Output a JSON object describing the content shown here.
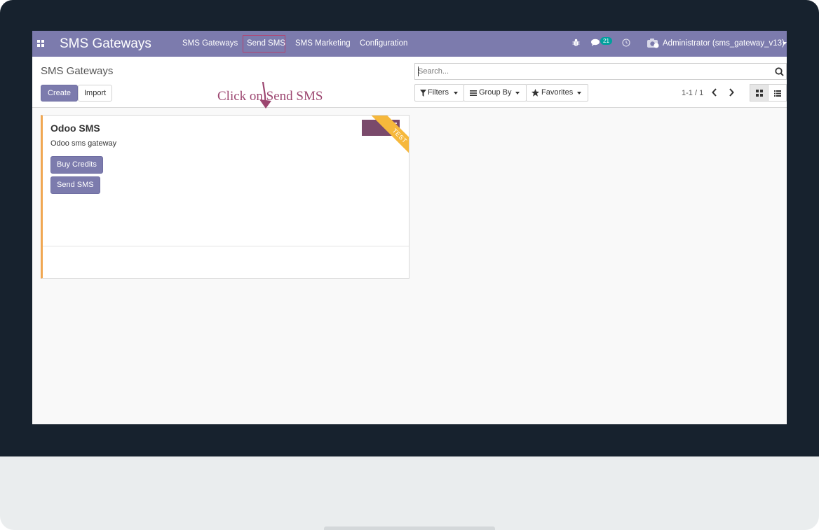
{
  "navbar": {
    "brand": "SMS Gateways",
    "menu": [
      "SMS Gateways",
      "Send SMS",
      "SMS Marketing",
      "Configuration"
    ],
    "messages_count": "21",
    "user": "Administrator (sms_gateway_v13)",
    "icons": [
      "apps-grid-icon",
      "bug-icon",
      "chat-icon",
      "clock-icon",
      "user-avatar-icon"
    ]
  },
  "control_panel": {
    "breadcrumb": "SMS Gateways",
    "create_label": "Create",
    "import_label": "Import",
    "search_placeholder": "Search...",
    "filters_label": "Filters",
    "group_by_label": "Group By",
    "favorites_label": "Favorites",
    "pager": "1-1 / 1"
  },
  "annotation": {
    "text": "Click on Send SMS",
    "color": "#9c4670"
  },
  "kanban": {
    "cards": [
      {
        "title": "Odoo SMS",
        "subtitle": "Odoo sms gateway",
        "ribbon": "TEST",
        "buttons": [
          "Buy Credits",
          "Send SMS"
        ]
      }
    ]
  },
  "colors": {
    "brand": "#7c7bad",
    "card_accent": "#f0a752",
    "ribbon": "#f6b83c",
    "badge": "#00a09d"
  }
}
